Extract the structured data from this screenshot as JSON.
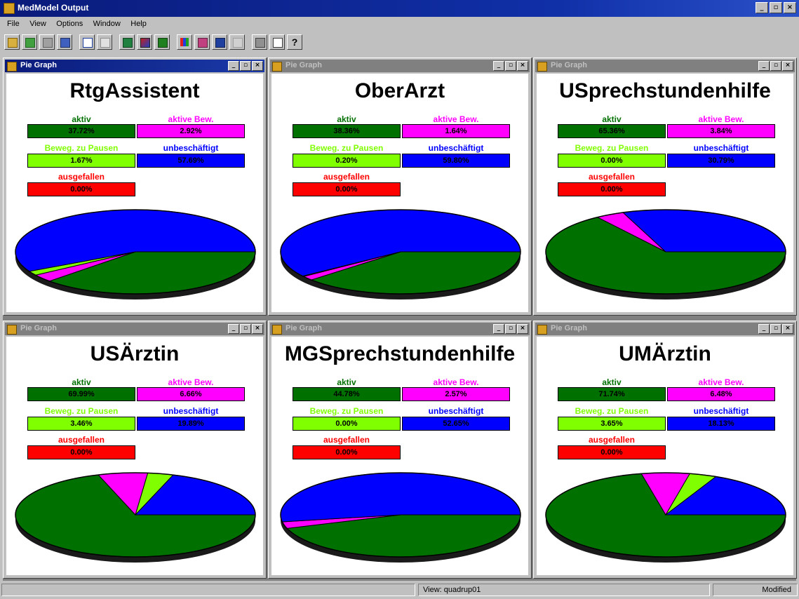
{
  "app": {
    "title": "MedModel Output",
    "icon": "app-icon"
  },
  "menu": [
    "File",
    "View",
    "Options",
    "Window",
    "Help"
  ],
  "toolbar": {
    "icons": [
      "open-icon",
      "open-model-icon",
      "save-icon",
      "export-icon",
      "report-icon",
      "blank-report-icon",
      "chart-icon",
      "plot-icon",
      "graph-icon",
      "histogram-icon",
      "edit-graph-icon",
      "statistics-icon",
      "disabled-icon",
      "print-icon",
      "print-preview-icon"
    ],
    "help_label": "?"
  },
  "legend_labels": {
    "aktiv": "aktiv",
    "aktive_bew": "aktive Bew.",
    "beweg": "Beweg. zu Pausen",
    "unbesch": "unbeschäftigt",
    "ausgefallen": "ausgefallen"
  },
  "colors": {
    "aktiv": "#007000",
    "aktive_bew": "#ff00ff",
    "beweg": "#80ff00",
    "unbesch": "#0000ff",
    "ausgefallen": "#ff0000"
  },
  "windows": [
    {
      "title": "Pie Graph",
      "heading": "RtgAssistent",
      "active": true,
      "values": {
        "aktiv": "37.72%",
        "aktive_bew": "2.92%",
        "beweg": "1.67%",
        "unbesch": "57.69%",
        "ausgefallen": "0.00%"
      },
      "fractions": [
        0.3772,
        0.0292,
        0.0167,
        0.5769,
        0.0
      ]
    },
    {
      "title": "Pie Graph",
      "heading": "OberArzt",
      "active": false,
      "values": {
        "aktiv": "38.36%",
        "aktive_bew": "1.64%",
        "beweg": "0.20%",
        "unbesch": "59.80%",
        "ausgefallen": "0.00%"
      },
      "fractions": [
        0.3836,
        0.0164,
        0.002,
        0.598,
        0.0
      ]
    },
    {
      "title": "Pie Graph",
      "heading": "USprechstundenhilfe",
      "active": false,
      "values": {
        "aktiv": "65.36%",
        "aktive_bew": "3.84%",
        "beweg": "0.00%",
        "unbesch": "30.79%",
        "ausgefallen": "0.00%"
      },
      "fractions": [
        0.6536,
        0.0384,
        0.0,
        0.3079,
        0.0
      ]
    },
    {
      "title": "Pie Graph",
      "heading": "USÄrztin",
      "active": false,
      "values": {
        "aktiv": "69.99%",
        "aktive_bew": "6.66%",
        "beweg": "3.46%",
        "unbesch": "19.89%",
        "ausgefallen": "0.00%"
      },
      "fractions": [
        0.6999,
        0.0666,
        0.0346,
        0.1989,
        0.0
      ]
    },
    {
      "title": "Pie Graph",
      "heading": "MGSprechstundenhilfe",
      "active": false,
      "values": {
        "aktiv": "44.78%",
        "aktive_bew": "2.57%",
        "beweg": "0.00%",
        "unbesch": "52.65%",
        "ausgefallen": "0.00%"
      },
      "fractions": [
        0.4478,
        0.0257,
        0.0,
        0.5265,
        0.0
      ]
    },
    {
      "title": "Pie Graph",
      "heading": "UMÄrztin",
      "active": false,
      "values": {
        "aktiv": "71.74%",
        "aktive_bew": "6.48%",
        "beweg": "3.65%",
        "unbesch": "18.13%",
        "ausgefallen": "0.00%"
      },
      "fractions": [
        0.7174,
        0.0648,
        0.0365,
        0.1813,
        0.0
      ]
    }
  ],
  "status": {
    "left": "",
    "view": "View:  quadrup01",
    "mode": "Modified"
  }
}
